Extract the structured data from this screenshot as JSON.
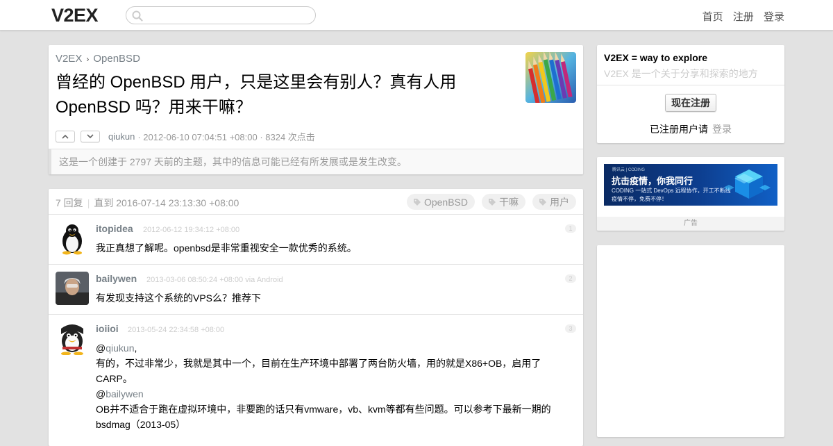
{
  "header": {
    "logo": "V2EX",
    "search_placeholder": "",
    "nav": [
      "首页",
      "注册",
      "登录"
    ]
  },
  "topic": {
    "breadcrumb": [
      "V2EX",
      "OpenBSD"
    ],
    "title": "曾经的 OpenBSD 用户，只是这里会有别人？真有人用 OpenBSD 吗？用来干嘛？",
    "author": "qiukun",
    "meta_rest": "· 2012-06-10 07:04:51 +08:00 · 8324 次点击",
    "notice": "这是一个创建于 2797 天前的主题，其中的信息可能已经有所发展或是发生改变。"
  },
  "replies": {
    "count": "7 回复",
    "until": "直到 2016-07-14 23:13:30 +08:00",
    "tags": [
      "OpenBSD",
      "干嘛",
      "用户"
    ],
    "items": [
      {
        "name": "itopidea",
        "time": "2012-06-12 19:34:12 +08:00",
        "no": "1",
        "body": "我正真想了解呢。openbsd是非常重视安全一款优秀的系统。"
      },
      {
        "name": "bailywen",
        "time": "2013-03-06 08:50:24 +08:00 via Android",
        "no": "2",
        "body": "有发现支持这个系统的VPS么？推荐下"
      },
      {
        "name": "ioiioi",
        "time": "2013-05-24 22:34:58 +08:00",
        "no": "3",
        "mention1": "qiukun",
        "line1_suffix": ",",
        "line2": "有的，不过非常少，我就是其中一个，目前在生产环境中部署了两台防火墙，用的就是X86+OB，启用了",
        "line3": "CARP。",
        "mention2": "bailywen",
        "line5": "OB并不适合于跑在虚拟环境中，非要跑的话只有vmware，vb、kvm等都有些问题。可以参考下最新一期的",
        "line6": "bsdmag（2013-05）"
      }
    ]
  },
  "sidebar": {
    "title": "V2EX = way to explore",
    "subtitle": "V2EX 是一个关于分享和探索的地方",
    "signup_button": "现在注册",
    "registered_text": "已注册用户请",
    "login_link": "登录",
    "ad": {
      "brand": "腾讯云 | CODING",
      "headline": "抗击疫情，你我同行",
      "line1": "CODING 一站式 DevOps 远程协作，开工不断线",
      "line2": "疫情不停，免费不停！",
      "label": "广告"
    }
  },
  "colors": {
    "page_bg": "#e2e2e2",
    "link_gray": "#778087",
    "muted": "#999999",
    "ad_bg": "#0d3e8f"
  }
}
